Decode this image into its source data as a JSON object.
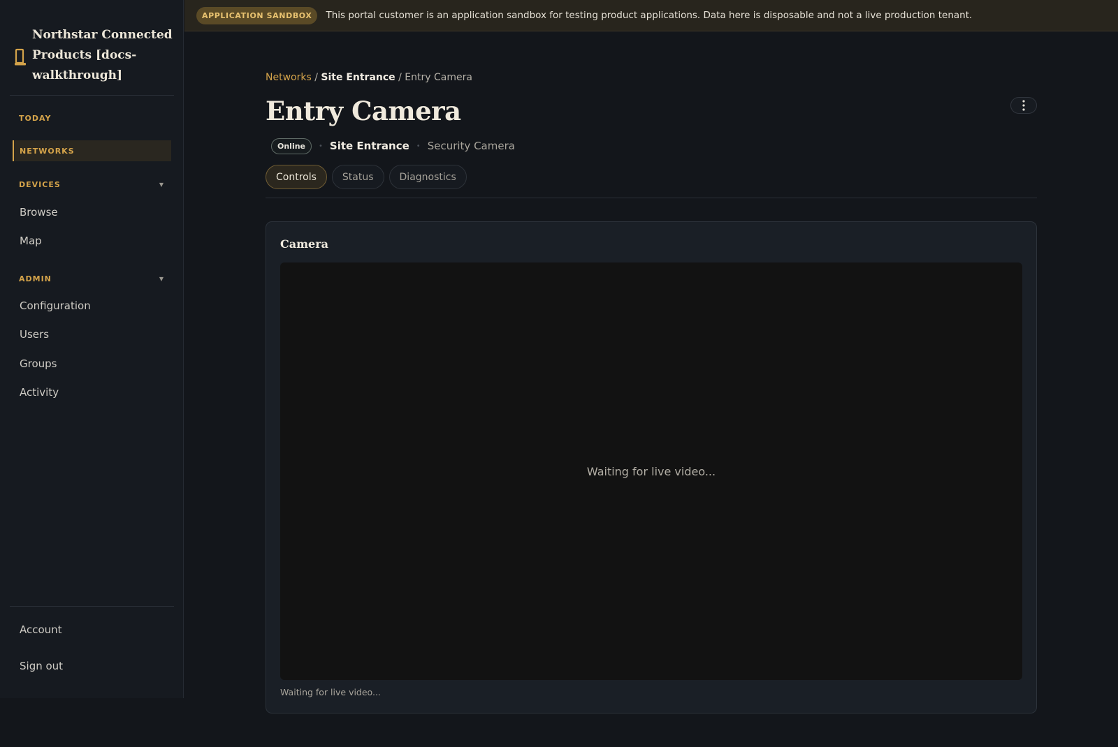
{
  "sidebar": {
    "brand_title": "Northstar Connected Products [docs-walkthrough]",
    "sections": {
      "today": "TODAY",
      "networks": "NETWORKS",
      "devices": "DEVICES",
      "admin": "ADMIN"
    },
    "devices_items": [
      "Browse",
      "Map"
    ],
    "admin_items": [
      "Configuration",
      "Users",
      "Groups",
      "Activity"
    ],
    "footer_items": [
      "Account",
      "Sign out"
    ],
    "active_section": "networks"
  },
  "banner": {
    "badge": "APPLICATION SANDBOX",
    "text": "This portal customer is an application sandbox for testing product applications. Data here is disposable and not a live production tenant."
  },
  "breadcrumb": {
    "networks": "Networks",
    "site": "Site Entrance",
    "current": "Entry Camera",
    "separator": "/"
  },
  "page": {
    "title": "Entry Camera",
    "status": "Online",
    "site": "Site Entrance",
    "device_type": "Security Camera"
  },
  "tabs": {
    "controls": "Controls",
    "status": "Status",
    "diagnostics": "Diagnostics",
    "active": "controls"
  },
  "camera_card": {
    "title": "Camera",
    "video_message": "Waiting for live video...",
    "caption": "Waiting for live video..."
  },
  "icons": {
    "brand": "device-icon",
    "more": "more-vertical-icon",
    "chevron": "chevron-down-icon"
  },
  "colors": {
    "accent": "#d4a34a",
    "background": "#13161b",
    "sidebar": "#161a20",
    "banner": "#28251d"
  }
}
